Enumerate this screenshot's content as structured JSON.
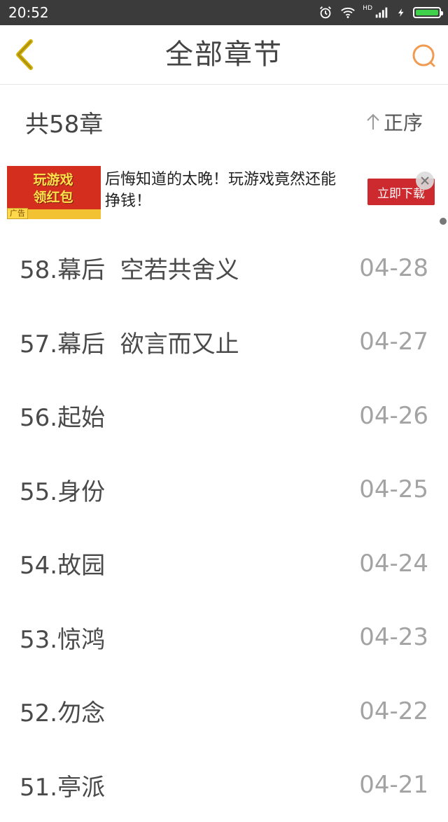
{
  "status_bar": {
    "time": "20:52",
    "network_label": "HD",
    "icons": [
      "alarm-icon",
      "wifi-icon",
      "signal-icon",
      "charging-icon",
      "battery-icon"
    ],
    "battery_color": "#3fd14a"
  },
  "header": {
    "title": "全部章节",
    "back_icon": "chevron-left-icon",
    "search_icon": "search-icon",
    "accent_back": "#d7b400",
    "accent_search": "#f09a52"
  },
  "summary": {
    "chapter_count": "共58章",
    "sort_label": "正序",
    "sort_icon": "arrow-up-icon"
  },
  "ad": {
    "image_text_line1": "玩游戏",
    "image_text_line2": "领红包",
    "badge": "广告",
    "text": "后悔知道的太晚！玩游戏竟然还能挣钱！",
    "cta": "立即下载",
    "close_icon": "close-icon"
  },
  "chapters": [
    {
      "title": "58.幕后  空若共舍义",
      "date": "04-28"
    },
    {
      "title": "57.幕后  欲言而又止",
      "date": "04-27"
    },
    {
      "title": "56.起始",
      "date": "04-26"
    },
    {
      "title": "55.身份",
      "date": "04-25"
    },
    {
      "title": "54.故园",
      "date": "04-24"
    },
    {
      "title": "53.惊鸿",
      "date": "04-23"
    },
    {
      "title": "52.勿念",
      "date": "04-22"
    },
    {
      "title": "51.亭派",
      "date": "04-21"
    }
  ]
}
